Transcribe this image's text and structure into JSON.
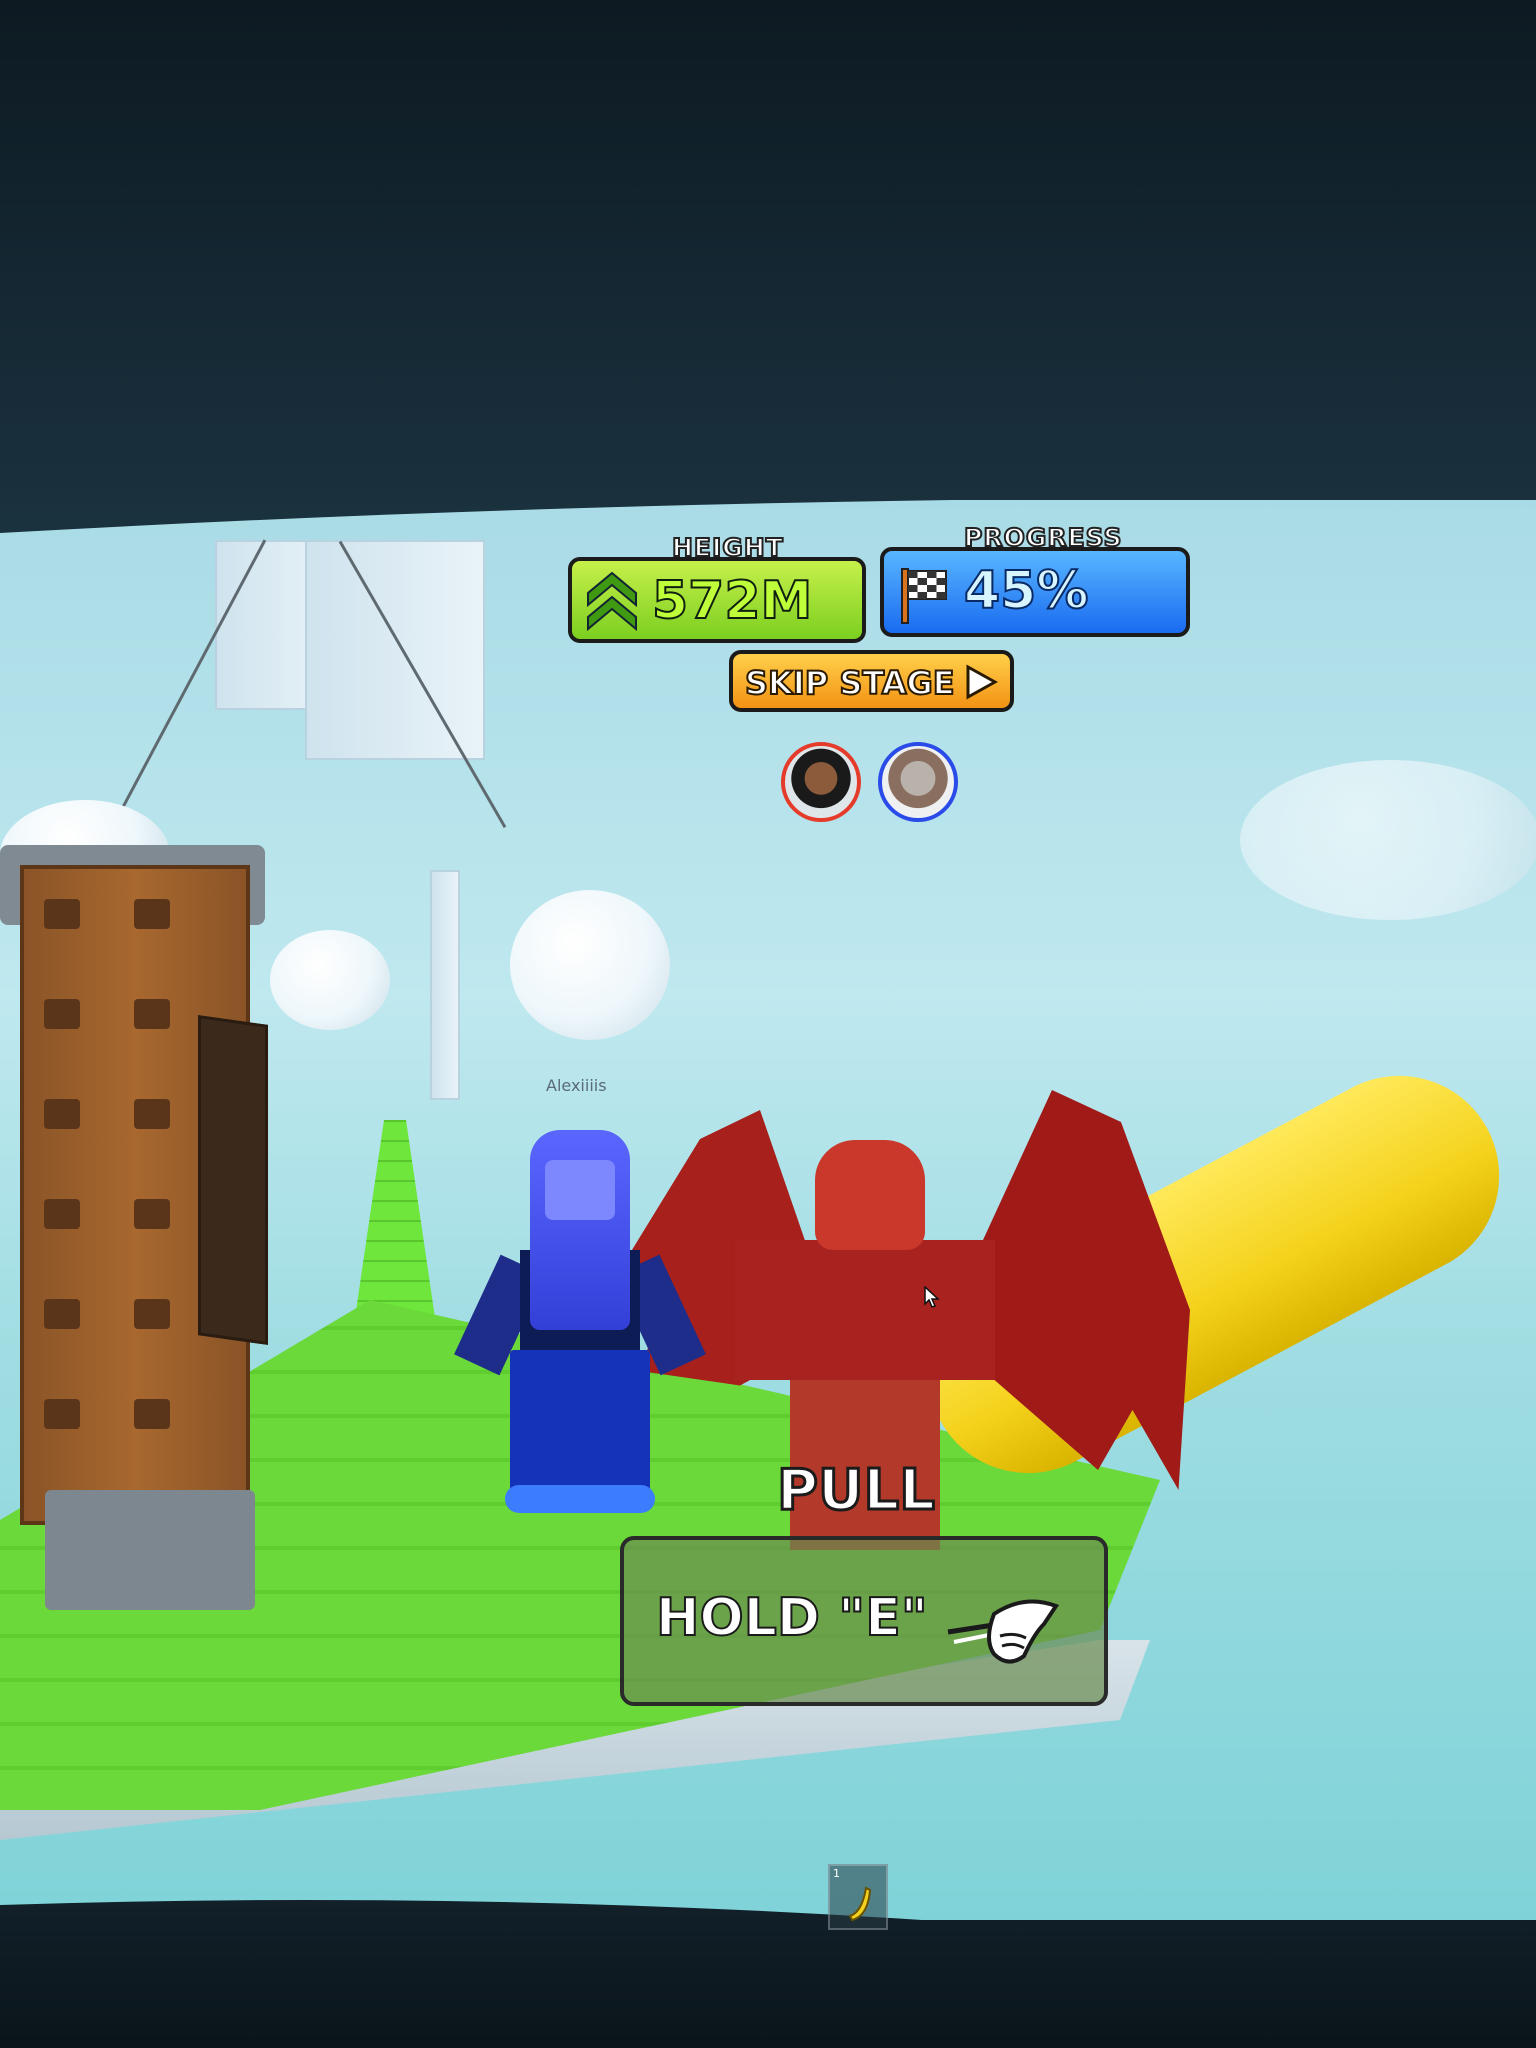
{
  "hud": {
    "height": {
      "title": "HEIGHT",
      "value": "572M",
      "icon": "double-chevron-up-icon"
    },
    "progress": {
      "title": "PROGRESS",
      "value": "45%",
      "fraction": 0.45,
      "icon": "checkered-flag-icon"
    },
    "skip_stage": {
      "label": "SKIP STAGE",
      "icon": "play-triangle-icon"
    }
  },
  "players": [
    {
      "avatar": "dark-hair-avatar",
      "ring_color": "#e53b2a"
    },
    {
      "avatar": "light-hair-avatar",
      "ring_color": "#2b4be8"
    }
  ],
  "world": {
    "player_name_tag": "Alexiiiis"
  },
  "prompt": {
    "action": "PULL",
    "key_hint": "HOLD \"E\"",
    "icon": "pulling-hand-icon"
  },
  "hotbar": {
    "slot_number": "1",
    "tool_icon": "banana-tool-icon"
  },
  "colors": {
    "height_panel": "#7ccf20",
    "progress_panel": "#1a6bf0",
    "skip_button": "#f39214",
    "platform": "#6bd93a"
  }
}
